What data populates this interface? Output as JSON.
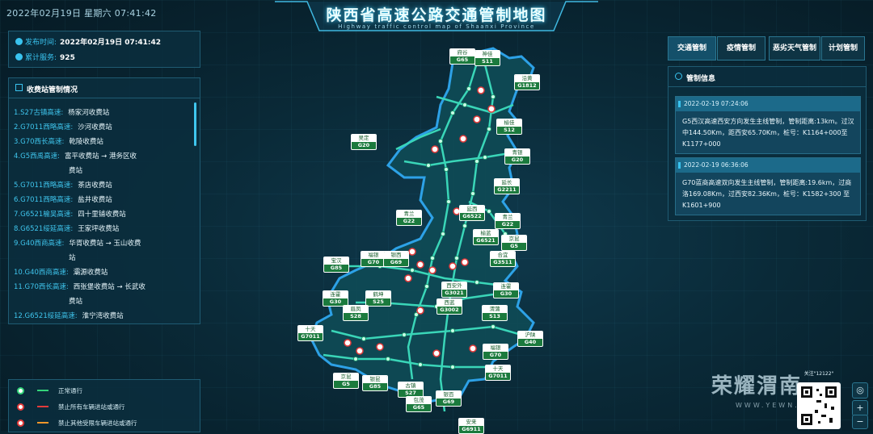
{
  "header": {
    "datetime": "2022年02月19日 星期六 07:41:42",
    "title": "陕西省高速公路交通管制地图",
    "subtitle": "Highway traffic control map of Shaanxi Province"
  },
  "publish": {
    "time_label": "发布时间:",
    "time_value": "2022年02月19日 07:41:42",
    "service_label": "累计服务:",
    "service_value": "925"
  },
  "toll_panel": {
    "title": "收费站管制情况",
    "items": [
      {
        "road": "1.S27古镇高速:",
        "station": "杨家河收费站",
        "cont": ""
      },
      {
        "road": "2.G7011西略高速:",
        "station": "沙河收费站",
        "cont": ""
      },
      {
        "road": "3.G70西长高速:",
        "station": "乾陵收费站",
        "cont": ""
      },
      {
        "road": "4.G5西禹高速:",
        "station": "富平收费站 → 港务区收",
        "cont": "费站"
      },
      {
        "road": "5.G7011西略高速:",
        "station": "茶店收费站",
        "cont": ""
      },
      {
        "road": "6.G7011西略高速:",
        "station": "盐井收费站",
        "cont": ""
      },
      {
        "road": "7.G6521榆吴高速:",
        "station": "四十里铺收费站",
        "cont": ""
      },
      {
        "road": "8.G6521绥延高速:",
        "station": "王家坪收费站",
        "cont": ""
      },
      {
        "road": "9.G40西商高速:",
        "station": "华胥收费站 → 玉山收费",
        "cont": "站"
      },
      {
        "road": "10.G40西商高速:",
        "station": "灞源收费站",
        "cont": ""
      },
      {
        "road": "11.G70西长高速:",
        "station": "西张堡收费站 → 长武收",
        "cont": "费站"
      },
      {
        "road": "12.G6521绥延高速:",
        "station": "淮宁湾收费站",
        "cont": ""
      }
    ]
  },
  "legend": [
    {
      "kind": "dot",
      "color": "#34d47a",
      "text": "正常通行"
    },
    {
      "kind": "ban-red",
      "color": "#e23b3b",
      "text": "禁止所有车辆进站或通行"
    },
    {
      "kind": "ban-orange",
      "color": "#f0962a",
      "text": "禁止其他受限车辆进站或通行"
    }
  ],
  "tabs": [
    "交通管制",
    "疫情管制",
    "恶劣天气管制",
    "计划管制"
  ],
  "info_panel": {
    "title": "管制信息",
    "cards": [
      {
        "time": "2022-02-19 07:24:06",
        "text": "G5西汉高速西安方向发生主线管制，管制距离:13km。过汉中144.50Km，距西安65.70Km，桩号：K1164+000至 K1177+000"
      },
      {
        "time": "2022-02-19 06:36:06",
        "text": "G70蓝商高速双向发生主线管制，管制距离:19.6km，过商洛169.08Km，过西安82.36Km，桩号：K1582+300 至K1601+900"
      }
    ]
  },
  "map_labels": [
    {
      "name": "府谷",
      "code": "G65"
    },
    {
      "name": "神佳",
      "code": "S11"
    },
    {
      "name": "沿黄",
      "code": "G1812"
    },
    {
      "name": "吴定",
      "code": "G20"
    },
    {
      "name": "榆佳",
      "code": "S12"
    },
    {
      "name": "青银",
      "code": "G20"
    },
    {
      "name": "延长",
      "code": "G2211"
    },
    {
      "name": "青兰",
      "code": "G22"
    },
    {
      "name": "延西",
      "code": "G6522"
    },
    {
      "name": "青兰",
      "code": "G22"
    },
    {
      "name": "榆蓝",
      "code": "G6521"
    },
    {
      "name": "京昆",
      "code": "G5"
    },
    {
      "name": "宝汉",
      "code": "G85"
    },
    {
      "name": "福银",
      "code": "G70"
    },
    {
      "name": "银西",
      "code": "G69"
    },
    {
      "name": "合宜",
      "code": "G3511"
    },
    {
      "name": "西安外",
      "code": "G3021"
    },
    {
      "name": "连霍",
      "code": "G30"
    },
    {
      "name": "连霍",
      "code": "G30"
    },
    {
      "name": "鹤坤",
      "code": "S25"
    },
    {
      "name": "眉凤",
      "code": "S28"
    },
    {
      "name": "西蓝",
      "code": "G3002"
    },
    {
      "name": "渭蒲",
      "code": "S13"
    },
    {
      "name": "十天",
      "code": "G7011"
    },
    {
      "name": "沪陕",
      "code": "G40"
    },
    {
      "name": "福银",
      "code": "G70"
    },
    {
      "name": "十天",
      "code": "G7011"
    },
    {
      "name": "京昆",
      "code": "G5"
    },
    {
      "name": "银昆",
      "code": "G85"
    },
    {
      "name": "古镇",
      "code": "S27"
    },
    {
      "name": "包茂",
      "code": "G65"
    },
    {
      "name": "银百",
      "code": "G69"
    },
    {
      "name": "安来",
      "code": "G6911"
    }
  ],
  "watermark": {
    "brand": "荣耀渭南",
    "url": "WWW.YEWN.CN",
    "qr_caption": "关注\"12122\""
  },
  "controls": [
    "locate-icon",
    "zoom-in-icon",
    "zoom-out-icon"
  ]
}
